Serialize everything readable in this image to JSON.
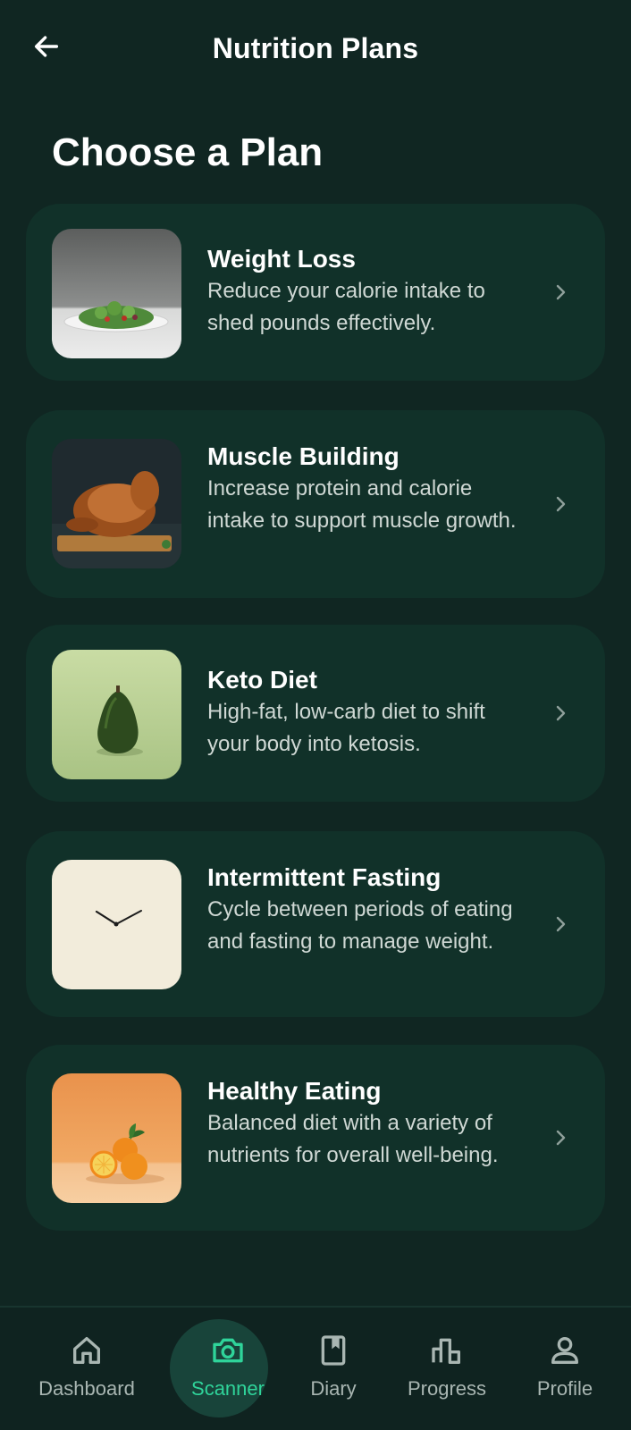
{
  "header": {
    "title": "Nutrition Plans",
    "back_icon": "arrow-left-icon"
  },
  "section_title": "Choose a Plan",
  "plans": [
    {
      "title": "Weight Loss",
      "description": "Reduce your calorie intake to shed pounds effectively.",
      "image": "salad-plate"
    },
    {
      "title": "Muscle Building",
      "description": "Increase protein and calorie intake to support muscle growth.",
      "image": "roast-chicken"
    },
    {
      "title": "Keto Diet",
      "description": "High-fat, low-carb diet to shift your body into ketosis.",
      "image": "avocado"
    },
    {
      "title": "Intermittent Fasting",
      "description": "Cycle between periods of eating and fasting to manage weight.",
      "image": "clock"
    },
    {
      "title": "Healthy Eating",
      "description": "Balanced diet with a variety of nutrients for overall well-being.",
      "image": "oranges"
    }
  ],
  "bottom_nav": {
    "active": "Scanner",
    "items": [
      {
        "label": "Dashboard",
        "icon": "home-icon"
      },
      {
        "label": "Scanner",
        "icon": "camera-icon"
      },
      {
        "label": "Diary",
        "icon": "book-icon"
      },
      {
        "label": "Progress",
        "icon": "bar-chart-icon"
      },
      {
        "label": "Profile",
        "icon": "person-icon"
      }
    ]
  },
  "colors": {
    "background": "#102622",
    "card": "#113129",
    "accent": "#2fd49a",
    "nav_inactive": "#a9b6b2"
  }
}
